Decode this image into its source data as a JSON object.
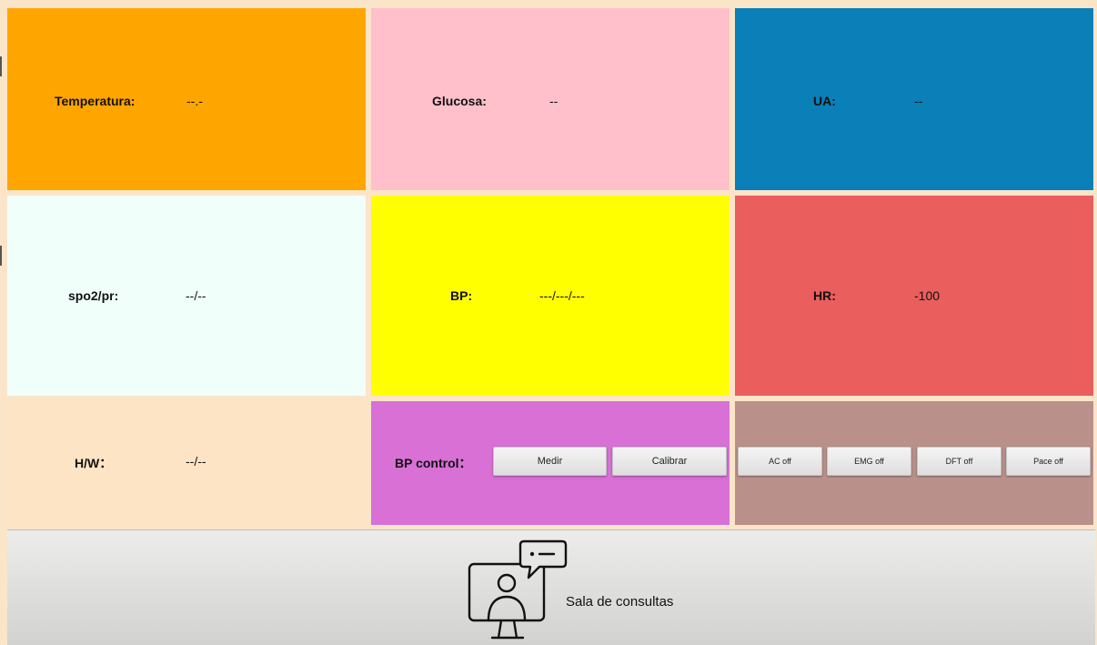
{
  "colors": {
    "background": "#fbe5c8",
    "temperatura": "#ffa500",
    "glucosa": "#ffc0cb",
    "ua": "#0a7fb8",
    "spo2": "#f0fffa",
    "bp": "#ffff00",
    "hr": "#ea5e5e",
    "hw": "#fde4c4",
    "bp_control": "#d870d6",
    "toggles": "#b9908a"
  },
  "vitals": {
    "temperatura": {
      "label": "Temperatura:",
      "value": "--.-"
    },
    "glucosa": {
      "label": "Glucosa:",
      "value": "--"
    },
    "ua": {
      "label": "UA:",
      "value": "--"
    },
    "spo2": {
      "label": "spo2/pr:",
      "value": "--/--"
    },
    "bp": {
      "label": "BP:",
      "value": "---/---/---"
    },
    "hr": {
      "label": "HR:",
      "value": "-100"
    },
    "hw": {
      "label": "H/W：",
      "value": "--/--"
    }
  },
  "bp_control": {
    "label": "BP control：",
    "measure_button": "Medir",
    "calibrate_button": "Calibrar"
  },
  "toggles": {
    "ac": "AC off",
    "emg": "EMG off",
    "dft": "DFT off",
    "pace": "Pace off"
  },
  "footer": {
    "icon": "video-consultation-icon",
    "label": "Sala de consultas"
  }
}
